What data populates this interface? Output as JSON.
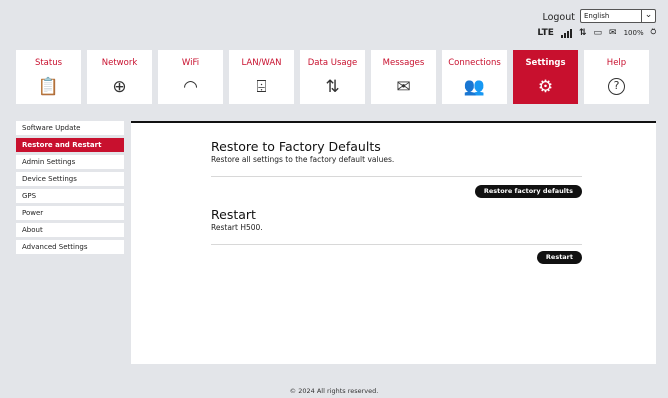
{
  "header": {
    "logout_label": "Logout",
    "language": {
      "selected": "English"
    },
    "network_type": "LTE",
    "battery": "100%"
  },
  "nav": {
    "tiles": [
      {
        "label": "Status",
        "icon": "clipboard-icon",
        "glyph": "📋"
      },
      {
        "label": "Network",
        "icon": "globe-icon",
        "glyph": "⊕"
      },
      {
        "label": "WiFi",
        "icon": "wifi-icon",
        "glyph": "◠"
      },
      {
        "label": "LAN/WAN",
        "icon": "network-tree-icon",
        "glyph": "⌹"
      },
      {
        "label": "Data Usage",
        "icon": "data-usage-icon",
        "glyph": "⇅"
      },
      {
        "label": "Messages",
        "icon": "envelope-icon",
        "glyph": "✉"
      },
      {
        "label": "Connections",
        "icon": "users-icon",
        "glyph": "👥"
      },
      {
        "label": "Settings",
        "icon": "gear-icon",
        "glyph": "⚙"
      },
      {
        "label": "Help",
        "icon": "help-icon",
        "glyph": "?"
      }
    ],
    "active": "Settings"
  },
  "sidebar": {
    "items": [
      {
        "label": "Software Update"
      },
      {
        "label": "Restore and Restart"
      },
      {
        "label": "Admin Settings"
      },
      {
        "label": "Device Settings"
      },
      {
        "label": "GPS"
      },
      {
        "label": "Power"
      },
      {
        "label": "About"
      },
      {
        "label": "Advanced Settings"
      }
    ],
    "active": "Restore and Restart"
  },
  "main": {
    "restore": {
      "title": "Restore to Factory Defaults",
      "description": "Restore all settings to the factory default values.",
      "button_label": "Restore factory defaults"
    },
    "restart": {
      "title": "Restart",
      "description": "Restart H500.",
      "button_label": "Restart"
    }
  },
  "footer": {
    "copyright": "© 2024 All rights reserved."
  },
  "colors": {
    "accent": "#c8102e",
    "background": "#e3e5e9"
  }
}
